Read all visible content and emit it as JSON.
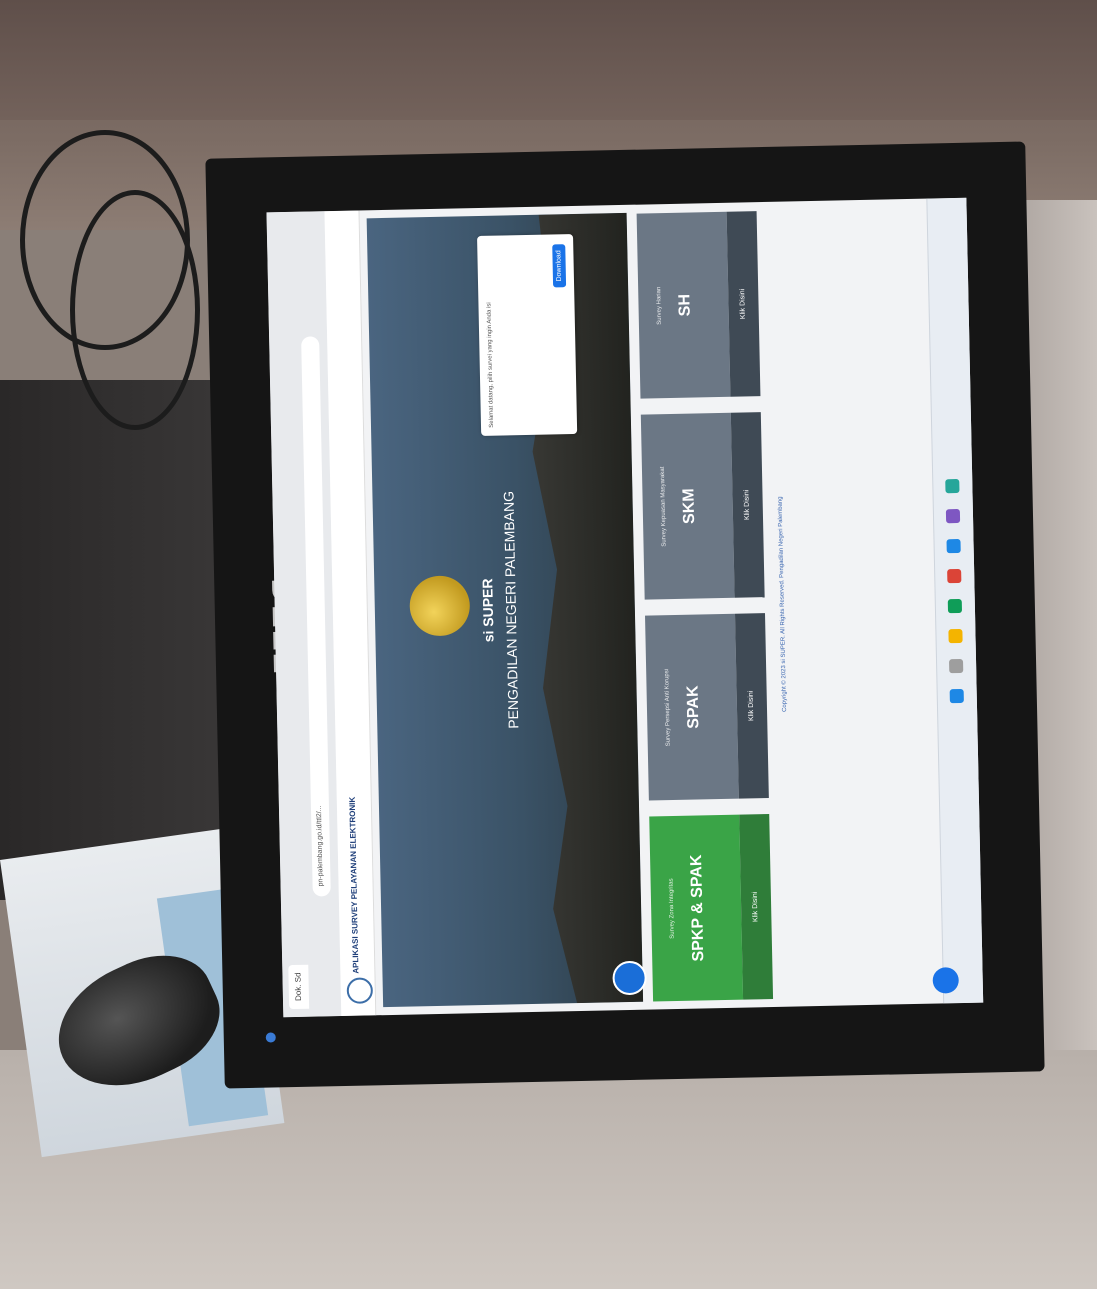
{
  "browser": {
    "tab_label": "Dok. Sd",
    "url": "pn-palembang.go.id/ttl2/..."
  },
  "page": {
    "app_title": "APLIKASI SURVEY PELAYANAN ELEKTRONIK",
    "hero_title": "si SUPER",
    "hero_subtitle": "PENGADILAN NEGERI PALEMBANG"
  },
  "cookie": {
    "text": "Selamat datang, pilih survei yang ingin Anda isi",
    "button": "Download"
  },
  "cards": [
    {
      "caption": "Survey Zona Integritas",
      "name": "SPKP & SPAK",
      "footer": "Klik Disini",
      "color": "#3aa447"
    },
    {
      "caption": "Survey Persepsi Anti Korupsi",
      "name": "SPAK",
      "footer": "Klik Disini",
      "color": "#6b7785"
    },
    {
      "caption": "Survey Kepuasan Masyarakat",
      "name": "SKM",
      "footer": "Klik Disini",
      "color": "#6b7785"
    },
    {
      "caption": "Survey Harian",
      "name": "SH",
      "footer": "Klik Disini",
      "color": "#6b7785"
    }
  ],
  "footer": {
    "text": "Copyright © 2023 si SUPER. All Rights Reserved. Pengadilan Negeri Palembang"
  },
  "monitor": {
    "brand": "DELL"
  },
  "colors": {
    "accent": "#1a73e8",
    "card_green": "#3aa447",
    "card_gray": "#6b7785"
  }
}
